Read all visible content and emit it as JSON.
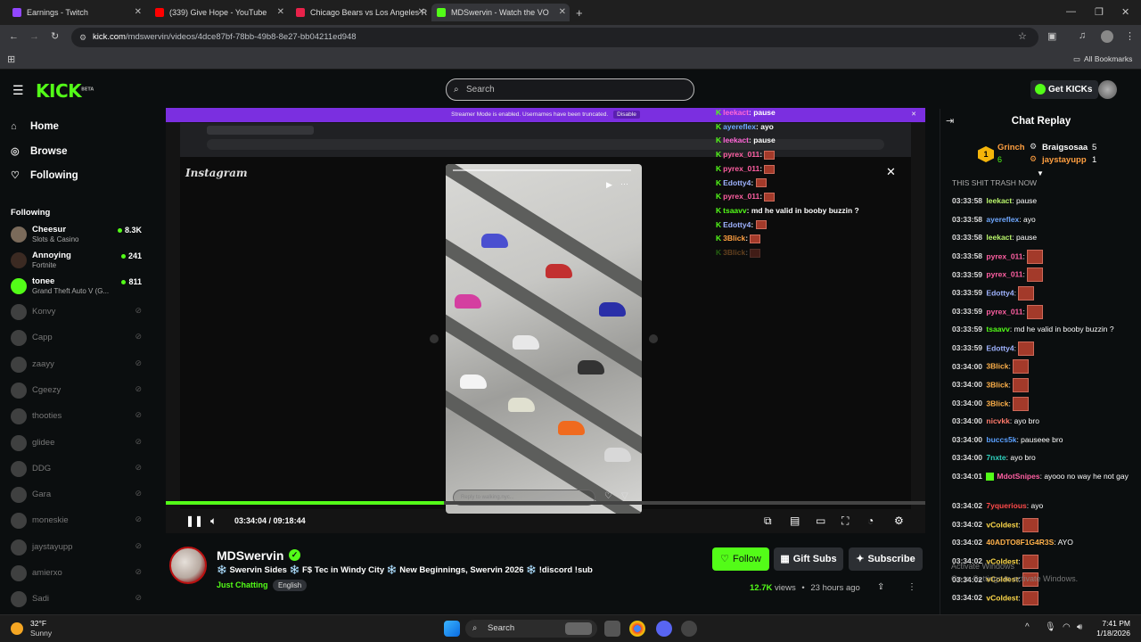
{
  "browser": {
    "tabs": [
      {
        "title": "Earnings - Twitch",
        "color": "#9146ff"
      },
      {
        "title": "(339) Give Hope - YouTube",
        "color": "#ff0000"
      },
      {
        "title": "Chicago Bears vs Los Angeles R",
        "color": "#e8224a"
      },
      {
        "title": "MDSwervin - Watch the VO",
        "color": "#53fc18"
      }
    ],
    "url_domain": "kick.com",
    "url_path": "/mdswervin/videos/4dce87bf-78bb-49b8-8e27-bb04211ed948",
    "bookmarks_label": "All Bookmarks"
  },
  "header": {
    "logo": "KICK",
    "logo_badge": "BETA",
    "search_placeholder": "Search",
    "get_kicks": "Get KICKs"
  },
  "sidebar": {
    "nav": [
      {
        "label": "Home",
        "icon": "home-icon"
      },
      {
        "label": "Browse",
        "icon": "compass-icon"
      },
      {
        "label": "Following",
        "icon": "heart-icon"
      }
    ],
    "following_heading": "Following",
    "live_channels": [
      {
        "name": "Cheesur",
        "game": "Slots & Casino",
        "viewers": "8.3K"
      },
      {
        "name": "Annoying",
        "game": "Fortnite",
        "viewers": "241"
      },
      {
        "name": "tonee",
        "game": "Grand Theft Auto V (G...",
        "viewers": "811"
      }
    ],
    "offline_channels": [
      "Konvy",
      "Capp",
      "zaayy",
      "Cgeezy",
      "thooties",
      "glidee",
      "DDG",
      "Gara",
      "moneskie",
      "jaystayupp",
      "amierxo",
      "Sadi"
    ]
  },
  "video": {
    "banner_text": "Streamer Mode is enabled. Usernames have been truncated.",
    "banner_button": "Disable",
    "instagram_logo": "Instagram",
    "story_reply_placeholder": "Reply to walking.nyc...",
    "overlay_chat": [
      {
        "user": "leekact",
        "msg": "pause",
        "color": "#ff66d6"
      },
      {
        "user": "ayereflex",
        "msg": "ayo",
        "color": "#6fa8ff"
      },
      {
        "user": "leekact",
        "msg": "pause",
        "color": "#ff66d6"
      },
      {
        "user": "pyrex_011",
        "msg": "",
        "emote": true,
        "color": "#ff5fa2"
      },
      {
        "user": "pyrex_011",
        "msg": "",
        "emote": true,
        "color": "#ff5fa2"
      },
      {
        "user": "Edotty4",
        "msg": "",
        "emote": true,
        "color": "#9fb3ff"
      },
      {
        "user": "pyrex_011",
        "msg": "",
        "emote": true,
        "color": "#ff5fa2"
      },
      {
        "user": "tsaavv",
        "msg": "md he valid in booby buzzin ?",
        "color": "#53fc18"
      },
      {
        "user": "Edotty4",
        "msg": "",
        "emote": true,
        "color": "#9fb3ff"
      },
      {
        "user": "3Blick",
        "msg": "",
        "emote": true,
        "color": "#ff9f40"
      },
      {
        "user": "3Blick",
        "msg": "",
        "emote": true,
        "color": "#ff9f40"
      }
    ],
    "current_time": "03:34:04",
    "duration": "09:18:44",
    "progress": 0.366
  },
  "stream_info": {
    "streamer": "MDSwervin",
    "title": "❄️ Swervin Sides ❄️ F$ Tec in Windy City ❄️ New Beginnings, Swervin 2026 ❄️ !discord !sub",
    "category": "Just Chatting",
    "language": "English",
    "follow_label": "Follow",
    "gift_label": "Gift Subs",
    "subscribe_label": "Subscribe",
    "views": "12.7K",
    "views_word": "views",
    "separator": "•",
    "age": "23 hours ago"
  },
  "chat": {
    "heading": "Chat Replay",
    "gifters": [
      {
        "name": "Grinch",
        "count": "6",
        "color": "#ff9f40"
      },
      {
        "name": "Braigsosaa",
        "count": "5",
        "color": "#ffffff"
      },
      {
        "name": "jaystayupp",
        "count": "1",
        "color": "#ff9f40"
      }
    ],
    "cut_message": "THIS SHIT TRASH NOW",
    "messages": [
      {
        "time": "03:33:58",
        "user": "leekact",
        "color": "#b9f56b",
        "msg": "pause"
      },
      {
        "time": "03:33:58",
        "user": "ayereflex",
        "color": "#6fa8ff",
        "msg": "ayo"
      },
      {
        "time": "03:33:58",
        "user": "leekact",
        "color": "#b9f56b",
        "msg": "pause"
      },
      {
        "time": "03:33:58",
        "user": "pyrex_011",
        "color": "#ff5fa2",
        "msg": "",
        "emote": true
      },
      {
        "time": "03:33:59",
        "user": "pyrex_011",
        "color": "#ff5fa2",
        "msg": "",
        "emote": true
      },
      {
        "time": "03:33:59",
        "user": "Edotty4",
        "color": "#9fb3ff",
        "msg": "",
        "emote": true
      },
      {
        "time": "03:33:59",
        "user": "pyrex_011",
        "color": "#ff5fa2",
        "msg": "",
        "emote": true
      },
      {
        "time": "03:33:59",
        "user": "tsaavv",
        "color": "#53fc18",
        "msg": "md he valid in booby buzzin ?"
      },
      {
        "time": "03:33:59",
        "user": "Edotty4",
        "color": "#9fb3ff",
        "msg": "",
        "emote": true
      },
      {
        "time": "03:34:00",
        "user": "3Blick",
        "color": "#ffb14a",
        "msg": "",
        "emote": true
      },
      {
        "time": "03:34:00",
        "user": "3Blick",
        "color": "#ffb14a",
        "msg": "",
        "emote": true
      },
      {
        "time": "03:34:00",
        "user": "3Blick",
        "color": "#ffb14a",
        "msg": "",
        "emote": true
      },
      {
        "time": "03:34:00",
        "user": "nicvkk",
        "color": "#ff7a6b",
        "msg": "ayo bro"
      },
      {
        "time": "03:34:00",
        "user": "buccs5k",
        "color": "#5aa0ff",
        "msg": "pauseee bro"
      },
      {
        "time": "03:34:00",
        "user": "7nxte",
        "color": "#2fd3c0",
        "msg": "ayo bro"
      },
      {
        "time": "03:34:01",
        "user": "MdotSnipes",
        "color": "#ff5fa2",
        "msg": "ayooo no way he not gay",
        "badge": true
      },
      {
        "time": "03:34:02",
        "user": "7yquerious",
        "color": "#ff4a4a",
        "msg": "ayo"
      },
      {
        "time": "03:34:02",
        "user": "vColdest",
        "color": "#ffd94a",
        "msg": "",
        "emote": true
      },
      {
        "time": "03:34:02",
        "user": "40ADTO8F1G4R3S",
        "color": "#ffb14a",
        "msg": "AYO"
      },
      {
        "time": "03:34:02",
        "user": "vColdest",
        "color": "#ffd94a",
        "msg": "",
        "emote": true
      },
      {
        "time": "03:34:02",
        "user": "vColdest",
        "color": "#ffd94a",
        "msg": "",
        "emote": true
      },
      {
        "time": "03:34:02",
        "user": "vColdest",
        "color": "#ffd94a",
        "msg": "",
        "emote": true
      }
    ]
  },
  "windows_watermark": {
    "line1": "Activate Windows",
    "line2": "Go to Settings to activate Windows."
  },
  "taskbar": {
    "temperature": "32°F",
    "weather": "Sunny",
    "search_label": "Search",
    "time": "7:41 PM",
    "date": "1/18/2026"
  }
}
